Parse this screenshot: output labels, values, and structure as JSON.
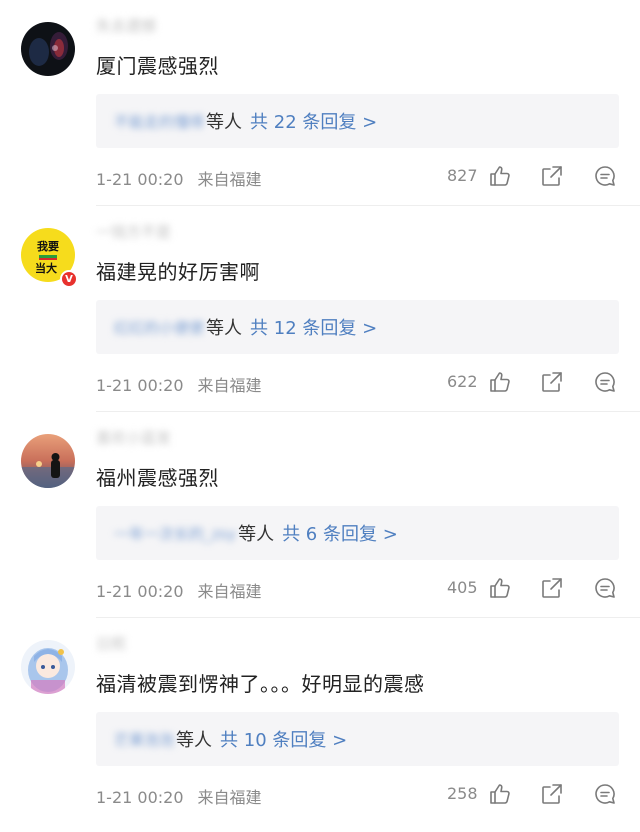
{
  "comments": [
    {
      "username": "失去遗憾",
      "text": "厦门震感强烈",
      "reply_names": "不能走的懂得",
      "reply_suffix": "等人",
      "reply_link": "共 22 条回复 >",
      "time": "1-21 00:20",
      "location": "来自福建",
      "likes": "827"
    },
    {
      "username": "一钱方不是",
      "text": "福建晃的好厉害啊",
      "reply_names": "红红的小便便",
      "reply_suffix": "等人",
      "reply_link": "共 12 条回复 >",
      "time": "1-21 00:20",
      "location": "来自福建",
      "likes": "622",
      "avatar_text_top": "我要",
      "avatar_text_bottom": "当大",
      "avatar_badge": "V"
    },
    {
      "username": "喜欢小蓝发",
      "text": "福州震感强烈",
      "reply_names": "一年一次长的_zsy",
      "reply_suffix": "等人",
      "reply_link": "共 6 条回复 >",
      "time": "1-21 00:20",
      "location": "来自福建",
      "likes": "405"
    },
    {
      "username": "日熙",
      "text": "福清被震到愣神了。。。好明显的震感",
      "reply_names": "芒果泡泡",
      "reply_suffix": "等人",
      "reply_link": "共 10 条回复 >",
      "time": "1-21 00:20",
      "location": "来自福建",
      "likes": "258"
    }
  ],
  "icons": {
    "like": "thumb-up-icon",
    "share": "share-icon",
    "reply": "comment-icon"
  },
  "colors": {
    "link": "#4f7fc0",
    "meta": "#8a8a8a",
    "reply_box": "#f5f5f7",
    "badge": "#e8322e"
  }
}
